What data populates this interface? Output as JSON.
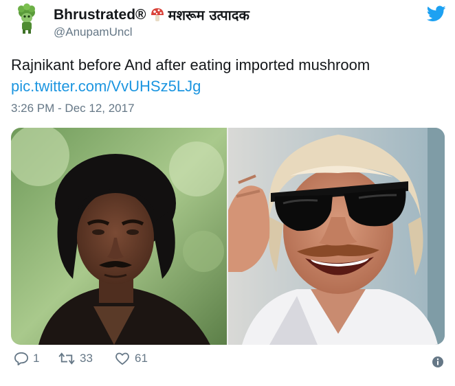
{
  "account": {
    "display_name": "Bhrustrated®",
    "display_name_hindi": "मशरूम उत्पादक",
    "handle": "@AnupamUncl"
  },
  "tweet": {
    "text": "Rajnikant before And after eating imported mushroom",
    "link": "pic.twitter.com/VvUHSz5LJg",
    "timestamp": "3:26 PM - Dec 12, 2017"
  },
  "actions": {
    "reply_count": "1",
    "retweet_count": "33",
    "like_count": "61"
  },
  "colors": {
    "link": "#1b95e0",
    "muted": "#657786",
    "brand": "#1da1f2"
  },
  "icons": [
    "avatar",
    "mushroom-emoji",
    "twitter-bird-icon",
    "reply-icon",
    "retweet-icon",
    "like-icon",
    "info-icon"
  ]
}
